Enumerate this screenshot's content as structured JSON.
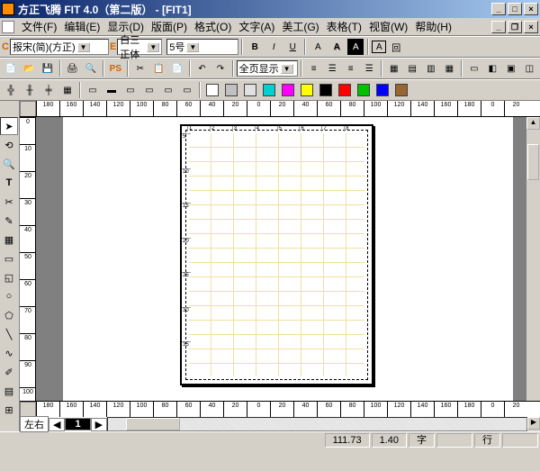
{
  "title": "方正飞腾 FIT 4.0（第二版） - [FIT1]",
  "menu": [
    "文件(F)",
    "编辑(E)",
    "显示(D)",
    "版面(P)",
    "格式(O)",
    "文字(A)",
    "美工(G)",
    "表格(T)",
    "视窗(W)",
    "帮助(H)"
  ],
  "font_family_prefix": "C",
  "font_family": "报宋(简)(方正)",
  "font_style_prefix": "E",
  "font_style": "白三正体",
  "font_size": "5号",
  "zoom": "全页显示",
  "ruler_top": [
    "180",
    "160",
    "140",
    "120",
    "100",
    "80",
    "60",
    "40",
    "20",
    "0",
    "20",
    "40",
    "60",
    "80",
    "100",
    "120",
    "140",
    "160",
    "180",
    "0",
    "20"
  ],
  "ruler_left": [
    "0",
    "10",
    "20",
    "30",
    "40",
    "50",
    "60",
    "70",
    "80",
    "90",
    "100"
  ],
  "ruler_bottom": [
    "180",
    "160",
    "140",
    "120",
    "100",
    "80",
    "60",
    "40",
    "20",
    "0",
    "20",
    "40",
    "60",
    "80",
    "100",
    "120",
    "140",
    "160",
    "180",
    "0",
    "20"
  ],
  "page_cols": [
    "1",
    "2",
    "3",
    "4",
    "5",
    "6",
    "7",
    "8"
  ],
  "page_rows": [
    "5",
    "10",
    "15",
    "20",
    "25",
    "30",
    "35"
  ],
  "page_nav": {
    "leftright": "左右",
    "current": "1"
  },
  "status": {
    "x": "111.73",
    "y": "1.40",
    "unit": "字",
    "line": "行"
  }
}
